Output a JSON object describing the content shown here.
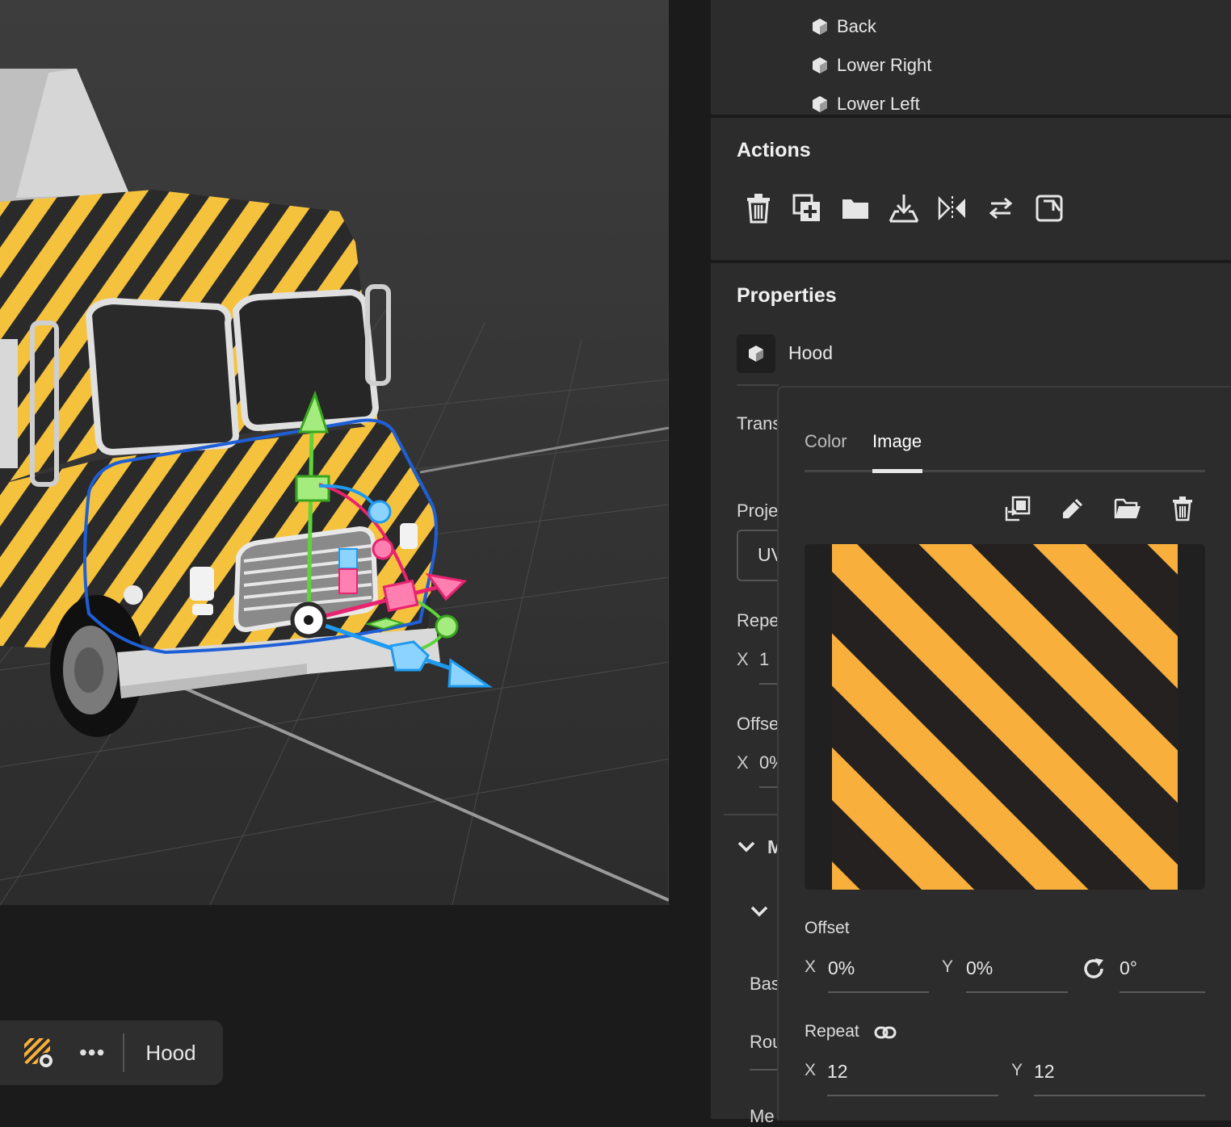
{
  "viewport": {
    "selected_object": "Hood",
    "toolbar": {
      "more_label": "•••",
      "object_label": "Hood"
    }
  },
  "layers": {
    "items": [
      {
        "label": "Back"
      },
      {
        "label": "Lower Right"
      },
      {
        "label": "Lower Left"
      }
    ]
  },
  "actions": {
    "title": "Actions",
    "buttons": [
      "delete-icon",
      "duplicate-icon",
      "group-folder-icon",
      "drop-to-ground-icon",
      "mirror-icon",
      "swap-icon",
      "export-icon"
    ]
  },
  "properties": {
    "title": "Properties",
    "object_name": "Hood",
    "hidden_labels": {
      "transform": "Trans",
      "projection": "Proje",
      "projection_value": "UV",
      "repeat": "Repe",
      "repeat_x_axis": "X",
      "repeat_x_value": "1",
      "offset": "Offse",
      "offset_x_axis": "X",
      "offset_x_value": "0%",
      "material_section": "M",
      "base": "Bas",
      "roughness": "Rou",
      "metal": "Me"
    }
  },
  "popover": {
    "tabs": [
      {
        "label": "Color",
        "active": false
      },
      {
        "label": "Image",
        "active": true
      }
    ],
    "image_tools": [
      "replace-image-icon",
      "edit-pencil-icon",
      "open-folder-icon",
      "delete-icon"
    ],
    "offset": {
      "label": "Offset",
      "x_axis": "X",
      "x_value": "0%",
      "y_axis": "Y",
      "y_value": "0%",
      "rotation_value": "0°"
    },
    "repeat": {
      "label": "Repeat",
      "x_axis": "X",
      "x_value": "12",
      "y_axis": "Y",
      "y_value": "12"
    }
  },
  "colors": {
    "stripe_orange": "#F9AF3C",
    "stripe_dark": "#242120",
    "panel_bg": "#2C2C2C",
    "viewport_bg": "#3A3A3A",
    "gizmo_green": "#5FD33A",
    "gizmo_pink": "#E8236F",
    "gizmo_blue": "#1E9BF0",
    "selection_outline": "#1F5FD6"
  }
}
